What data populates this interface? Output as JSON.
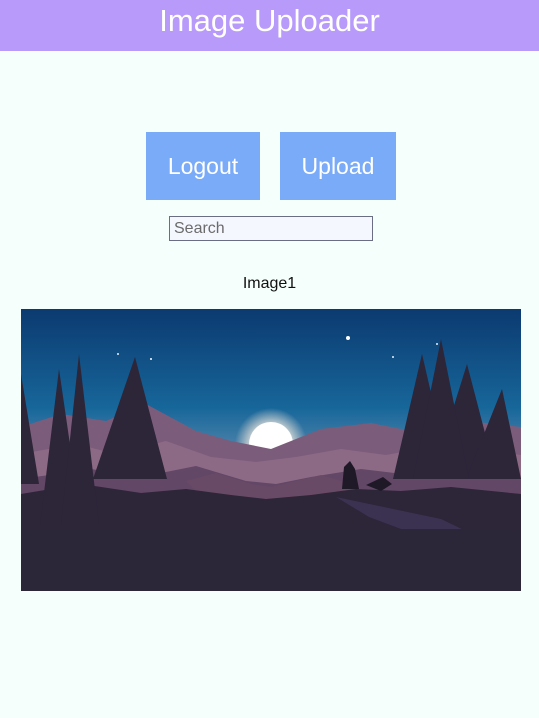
{
  "header": {
    "title": "Image Uploader"
  },
  "toolbar": {
    "logout_label": "Logout",
    "upload_label": "Upload"
  },
  "search": {
    "placeholder": "Search",
    "value": ""
  },
  "gallery": {
    "items": [
      {
        "caption": "Image1"
      }
    ]
  },
  "colors": {
    "header_bg": "#B89AFB",
    "button_bg": "#7AABF8",
    "page_bg": "#F5FFFB"
  }
}
